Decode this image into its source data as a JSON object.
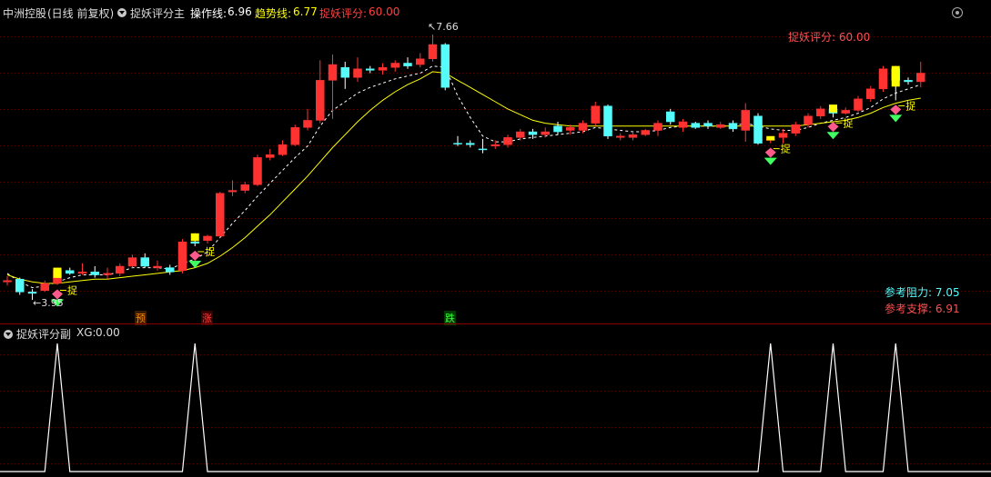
{
  "header": {
    "stock_name": "中洲控股",
    "period_info": "(日线 前复权)",
    "indicator_name": "捉妖评分主",
    "op_line_label": "操作线:",
    "op_line_value": "6.96",
    "trend_line_label": "趋势线:",
    "trend_line_value": "6.77",
    "score_label": "捉妖评分:",
    "score_value": "60.00"
  },
  "main_panel": {
    "score_label": "捉妖评分: 60.00",
    "high_label": "7.66",
    "low_label": "3.95",
    "resistance_label": "参考阻力:",
    "resistance_value": "7.05",
    "support_label": "参考支撑:",
    "support_value": "6.91",
    "buy_marker_text": "捉",
    "event_markers": [
      "预",
      "涨",
      "跌"
    ]
  },
  "sub_panel": {
    "title": "捉妖评分副",
    "xg_label": "XG:",
    "xg_value": "0.00"
  },
  "colors": {
    "up": "#ff3232",
    "down": "#54fcfc",
    "op_line": "#ffffff",
    "trend_line": "#ffff00",
    "score": "#ff5050",
    "grid": "#5a0000"
  },
  "chart_data": {
    "type": "candlestick",
    "price_range": [
      3.95,
      7.66
    ],
    "candles": [
      {
        "o": 4.2,
        "h": 4.28,
        "l": 4.15,
        "c": 4.22,
        "up": true
      },
      {
        "o": 4.24,
        "h": 4.26,
        "l": 4.02,
        "c": 4.06,
        "up": false
      },
      {
        "o": 4.06,
        "h": 4.1,
        "l": 3.95,
        "c": 4.04,
        "up": false
      },
      {
        "o": 4.08,
        "h": 4.22,
        "l": 4.06,
        "c": 4.18,
        "up": true
      },
      {
        "o": 4.18,
        "h": 4.4,
        "l": 4.16,
        "c": 4.36,
        "up": true
      },
      {
        "o": 4.36,
        "h": 4.4,
        "l": 4.3,
        "c": 4.32,
        "up": false
      },
      {
        "o": 4.32,
        "h": 4.46,
        "l": 4.3,
        "c": 4.34,
        "up": true
      },
      {
        "o": 4.34,
        "h": 4.42,
        "l": 4.26,
        "c": 4.3,
        "up": false
      },
      {
        "o": 4.3,
        "h": 4.4,
        "l": 4.24,
        "c": 4.32,
        "up": true
      },
      {
        "o": 4.32,
        "h": 4.46,
        "l": 4.28,
        "c": 4.42,
        "up": true
      },
      {
        "o": 4.42,
        "h": 4.58,
        "l": 4.4,
        "c": 4.54,
        "up": true
      },
      {
        "o": 4.54,
        "h": 4.6,
        "l": 4.4,
        "c": 4.42,
        "up": false
      },
      {
        "o": 4.42,
        "h": 4.5,
        "l": 4.36,
        "c": 4.4,
        "up": true
      },
      {
        "o": 4.4,
        "h": 4.44,
        "l": 4.3,
        "c": 4.34,
        "up": false
      },
      {
        "o": 4.36,
        "h": 4.8,
        "l": 4.32,
        "c": 4.76,
        "up": true
      },
      {
        "o": 4.76,
        "h": 4.88,
        "l": 4.7,
        "c": 4.74,
        "up": false
      },
      {
        "o": 4.78,
        "h": 4.86,
        "l": 4.74,
        "c": 4.84,
        "up": true
      },
      {
        "o": 4.84,
        "h": 5.46,
        "l": 4.82,
        "c": 5.44,
        "up": true
      },
      {
        "o": 5.46,
        "h": 5.62,
        "l": 5.4,
        "c": 5.48,
        "up": true
      },
      {
        "o": 5.48,
        "h": 5.6,
        "l": 5.44,
        "c": 5.56,
        "up": true
      },
      {
        "o": 5.56,
        "h": 5.98,
        "l": 5.54,
        "c": 5.94,
        "up": true
      },
      {
        "o": 5.94,
        "h": 6.06,
        "l": 5.9,
        "c": 5.98,
        "up": true
      },
      {
        "o": 5.98,
        "h": 6.18,
        "l": 5.96,
        "c": 6.12,
        "up": true
      },
      {
        "o": 6.12,
        "h": 6.4,
        "l": 6.1,
        "c": 6.36,
        "up": true
      },
      {
        "o": 6.36,
        "h": 6.62,
        "l": 6.32,
        "c": 6.46,
        "up": true
      },
      {
        "o": 6.46,
        "h": 7.3,
        "l": 6.42,
        "c": 7.02,
        "up": true
      },
      {
        "o": 7.02,
        "h": 7.38,
        "l": 6.48,
        "c": 7.24,
        "up": true
      },
      {
        "o": 7.2,
        "h": 7.28,
        "l": 6.9,
        "c": 7.06,
        "up": false
      },
      {
        "o": 7.06,
        "h": 7.34,
        "l": 7.0,
        "c": 7.18,
        "up": true
      },
      {
        "o": 7.18,
        "h": 7.22,
        "l": 7.12,
        "c": 7.16,
        "up": false
      },
      {
        "o": 7.16,
        "h": 7.26,
        "l": 7.1,
        "c": 7.2,
        "up": true
      },
      {
        "o": 7.2,
        "h": 7.3,
        "l": 7.14,
        "c": 7.26,
        "up": true
      },
      {
        "o": 7.26,
        "h": 7.34,
        "l": 7.18,
        "c": 7.22,
        "up": false
      },
      {
        "o": 7.24,
        "h": 7.4,
        "l": 7.2,
        "c": 7.32,
        "up": true
      },
      {
        "o": 7.32,
        "h": 7.66,
        "l": 7.28,
        "c": 7.52,
        "up": true
      },
      {
        "o": 7.52,
        "h": 7.54,
        "l": 6.88,
        "c": 6.92,
        "up": false
      },
      {
        "o": 6.14,
        "h": 6.24,
        "l": 6.1,
        "c": 6.14,
        "up": false
      },
      {
        "o": 6.14,
        "h": 6.18,
        "l": 6.08,
        "c": 6.12,
        "up": false
      },
      {
        "o": 6.06,
        "h": 6.2,
        "l": 6.0,
        "c": 6.06,
        "up": false
      },
      {
        "o": 6.1,
        "h": 6.18,
        "l": 6.06,
        "c": 6.12,
        "up": true
      },
      {
        "o": 6.12,
        "h": 6.26,
        "l": 6.08,
        "c": 6.22,
        "up": true
      },
      {
        "o": 6.22,
        "h": 6.34,
        "l": 6.18,
        "c": 6.3,
        "up": true
      },
      {
        "o": 6.3,
        "h": 6.34,
        "l": 6.2,
        "c": 6.26,
        "up": false
      },
      {
        "o": 6.26,
        "h": 6.36,
        "l": 6.22,
        "c": 6.3,
        "up": true
      },
      {
        "o": 6.3,
        "h": 6.44,
        "l": 6.26,
        "c": 6.38,
        "up": false
      },
      {
        "o": 6.36,
        "h": 6.4,
        "l": 6.26,
        "c": 6.32,
        "up": true
      },
      {
        "o": 6.32,
        "h": 6.46,
        "l": 6.28,
        "c": 6.42,
        "up": true
      },
      {
        "o": 6.42,
        "h": 6.72,
        "l": 6.38,
        "c": 6.66,
        "up": true
      },
      {
        "o": 6.66,
        "h": 6.68,
        "l": 6.2,
        "c": 6.24,
        "up": false
      },
      {
        "o": 6.24,
        "h": 6.28,
        "l": 6.18,
        "c": 6.22,
        "up": true
      },
      {
        "o": 6.22,
        "h": 6.3,
        "l": 6.18,
        "c": 6.26,
        "up": true
      },
      {
        "o": 6.26,
        "h": 6.34,
        "l": 6.24,
        "c": 6.32,
        "up": true
      },
      {
        "o": 6.32,
        "h": 6.46,
        "l": 6.24,
        "c": 6.42,
        "up": true
      },
      {
        "o": 6.44,
        "h": 6.62,
        "l": 6.4,
        "c": 6.58,
        "up": false
      },
      {
        "o": 6.44,
        "h": 6.48,
        "l": 6.3,
        "c": 6.36,
        "up": true
      },
      {
        "o": 6.36,
        "h": 6.44,
        "l": 6.34,
        "c": 6.42,
        "up": false
      },
      {
        "o": 6.42,
        "h": 6.46,
        "l": 6.34,
        "c": 6.38,
        "up": false
      },
      {
        "o": 6.36,
        "h": 6.44,
        "l": 6.34,
        "c": 6.4,
        "up": true
      },
      {
        "o": 6.42,
        "h": 6.46,
        "l": 6.3,
        "c": 6.34,
        "up": false
      },
      {
        "o": 6.32,
        "h": 6.7,
        "l": 6.16,
        "c": 6.6,
        "up": true
      },
      {
        "o": 6.52,
        "h": 6.56,
        "l": 6.12,
        "c": 6.14,
        "up": false
      },
      {
        "o": 6.2,
        "h": 6.24,
        "l": 6.14,
        "c": 6.18,
        "up": true
      },
      {
        "o": 6.22,
        "h": 6.34,
        "l": 6.14,
        "c": 6.28,
        "up": true
      },
      {
        "o": 6.28,
        "h": 6.44,
        "l": 6.24,
        "c": 6.4,
        "up": true
      },
      {
        "o": 6.4,
        "h": 6.56,
        "l": 6.36,
        "c": 6.52,
        "up": true
      },
      {
        "o": 6.52,
        "h": 6.66,
        "l": 6.48,
        "c": 6.62,
        "up": true
      },
      {
        "o": 6.62,
        "h": 6.68,
        "l": 6.5,
        "c": 6.56,
        "up": false
      },
      {
        "o": 6.56,
        "h": 6.64,
        "l": 6.54,
        "c": 6.6,
        "up": true
      },
      {
        "o": 6.6,
        "h": 6.8,
        "l": 6.58,
        "c": 6.76,
        "up": true
      },
      {
        "o": 6.76,
        "h": 6.94,
        "l": 6.72,
        "c": 6.9,
        "up": true
      },
      {
        "o": 6.9,
        "h": 7.22,
        "l": 6.86,
        "c": 7.18,
        "up": true
      },
      {
        "o": 7.18,
        "h": 7.22,
        "l": 6.74,
        "c": 7.02,
        "up": false
      },
      {
        "o": 7.02,
        "h": 7.06,
        "l": 6.96,
        "c": 7.0,
        "up": false
      },
      {
        "o": 7.0,
        "h": 7.28,
        "l": 6.92,
        "c": 7.12,
        "up": true
      }
    ],
    "op_line": [
      4.32,
      4.2,
      4.12,
      4.14,
      4.2,
      4.26,
      4.3,
      4.3,
      4.3,
      4.34,
      4.4,
      4.4,
      4.4,
      4.38,
      4.46,
      4.52,
      4.62,
      4.82,
      5.02,
      5.2,
      5.4,
      5.58,
      5.76,
      5.94,
      6.1,
      6.38,
      6.6,
      6.72,
      6.84,
      6.92,
      6.98,
      7.04,
      7.08,
      7.12,
      7.22,
      7.2,
      6.8,
      6.5,
      6.24,
      6.16,
      6.16,
      6.2,
      6.22,
      6.24,
      6.26,
      6.28,
      6.3,
      6.36,
      6.34,
      6.32,
      6.3,
      6.3,
      6.32,
      6.36,
      6.38,
      6.38,
      6.38,
      6.38,
      6.38,
      6.42,
      6.38,
      6.34,
      6.32,
      6.32,
      6.36,
      6.42,
      6.46,
      6.5,
      6.56,
      6.64,
      6.76,
      6.84,
      6.9,
      6.96
    ],
    "trend_line": [
      4.3,
      4.24,
      4.2,
      4.18,
      4.18,
      4.2,
      4.22,
      4.24,
      4.24,
      4.26,
      4.28,
      4.3,
      4.32,
      4.34,
      4.36,
      4.4,
      4.46,
      4.56,
      4.68,
      4.82,
      4.98,
      5.14,
      5.32,
      5.5,
      5.68,
      5.88,
      6.08,
      6.26,
      6.44,
      6.6,
      6.74,
      6.86,
      6.96,
      7.04,
      7.14,
      7.12,
      7.02,
      6.92,
      6.82,
      6.72,
      6.62,
      6.54,
      6.46,
      6.42,
      6.4,
      6.38,
      6.38,
      6.38,
      6.38,
      6.38,
      6.38,
      6.38,
      6.38,
      6.38,
      6.38,
      6.38,
      6.38,
      6.38,
      6.38,
      6.38,
      6.38,
      6.38,
      6.38,
      6.38,
      6.4,
      6.42,
      6.44,
      6.46,
      6.5,
      6.56,
      6.64,
      6.7,
      6.74,
      6.77
    ],
    "buy_signal_indices": [
      4,
      15,
      61,
      66,
      71
    ],
    "xg_peak_indices": [
      4,
      15,
      61,
      66,
      71
    ],
    "xg_range": [
      0,
      1
    ]
  }
}
